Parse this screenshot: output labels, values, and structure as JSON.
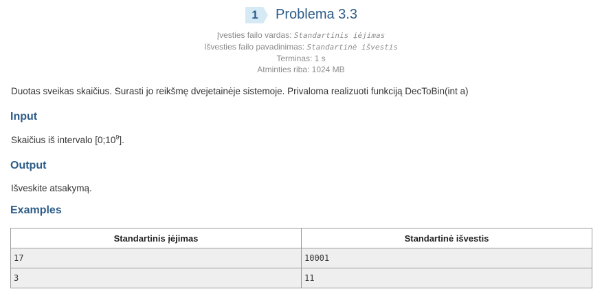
{
  "problem": {
    "number": "1",
    "title": "Problema 3.3",
    "badge_color": "#d6eaf5",
    "accent_color": "#2d5c88"
  },
  "meta": {
    "input_file_label": "Įvesties failo vardas:",
    "input_file_value": "Standartinis įėjimas",
    "output_file_label": "Išvesties failo pavadinimas:",
    "output_file_value": "Standartinė išvestis",
    "time_limit": "Terminas: 1 s",
    "memory_limit": "Atminties riba: 1024 MB"
  },
  "statement": "Duotas sveikas skaičius. Surasti jo reikšmę dvejetainėje sistemoje. Privaloma realizuoti funkciją DecToBin(int a)",
  "input_section": {
    "title": "Input",
    "text_prefix": "Skaičius iš intervalo [0;10",
    "text_exponent": "9",
    "text_suffix": "]."
  },
  "output_section": {
    "title": "Output",
    "text": "Išveskite atsakymą."
  },
  "examples_section": {
    "title": "Examples",
    "columns": [
      "Standartinis įėjimas",
      "Standartinė išvestis"
    ],
    "rows": [
      [
        "17",
        "10001"
      ],
      [
        "3",
        "11"
      ]
    ]
  }
}
